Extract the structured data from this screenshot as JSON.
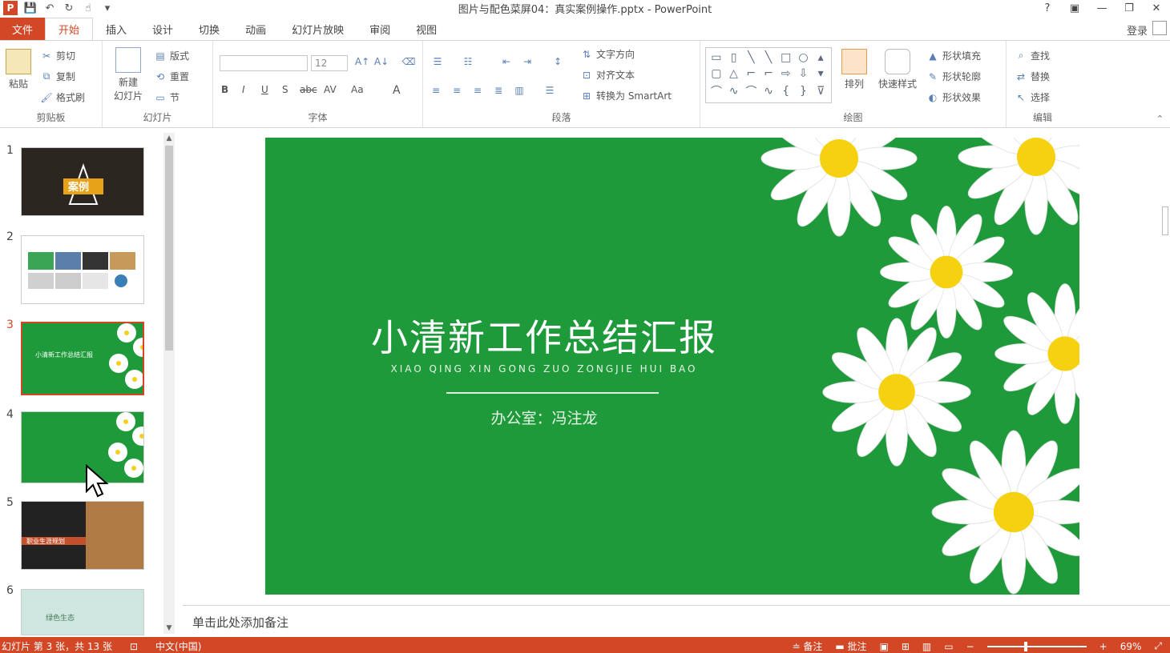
{
  "titlebar": {
    "title": "图片与配色菜屏04：真实案例操作.pptx - PowerPoint",
    "qa_icons": [
      "save-icon",
      "undo-icon",
      "redo-icon",
      "touch-mode-icon",
      "customize-icon"
    ],
    "controls": {
      "help": "?",
      "ribbon_options": "▣",
      "minimize": "—",
      "restore": "❐",
      "close": "✕"
    }
  },
  "tabs": {
    "items": [
      "文件",
      "开始",
      "插入",
      "设计",
      "切换",
      "动画",
      "幻灯片放映",
      "审阅",
      "视图"
    ],
    "active": "开始",
    "login": "登录"
  },
  "ribbon": {
    "clipboard": {
      "paste": "粘贴",
      "cut": "剪切",
      "copy": "复制",
      "format_painter": "格式刷",
      "label": "剪贴板"
    },
    "slides": {
      "new_slide": "新建\n幻灯片",
      "layout": "版式",
      "reset": "重置",
      "section": "节",
      "label": "幻灯片"
    },
    "font": {
      "font_size": "12",
      "bold": "B",
      "italic": "I",
      "underline": "U",
      "shadow": "S",
      "strike": "abc",
      "spacing": "AV",
      "case": "Aa",
      "color": "A",
      "label": "字体"
    },
    "paragraph": {
      "text_direction": "文字方向",
      "align_text": "对齐文本",
      "smartart": "转换为 SmartArt",
      "label": "段落"
    },
    "drawing": {
      "arrange": "排列",
      "quick_styles": "快速样式",
      "shape_fill": "形状填充",
      "shape_outline": "形状轮廓",
      "shape_effects": "形状效果",
      "label": "绘图"
    },
    "editing": {
      "find": "查找",
      "replace": "替换",
      "select": "选择",
      "label": "编辑"
    }
  },
  "thumbnails": [
    {
      "num": "1",
      "inner": "案例"
    },
    {
      "num": "2",
      "inner": ""
    },
    {
      "num": "3",
      "inner": "小清新工作总结汇报"
    },
    {
      "num": "4",
      "inner": ""
    },
    {
      "num": "5",
      "inner": "职业生涯规划"
    },
    {
      "num": "6",
      "inner": "绿色生态"
    }
  ],
  "slide": {
    "title": "小清新工作总结汇报",
    "pinyin": "XIAO QING XIN GONG ZUO ZONGJIE HUI BAO",
    "author": "办公室：冯注龙"
  },
  "notes": {
    "placeholder": "单击此处添加备注"
  },
  "status": {
    "slide_info": "幻灯片 第 3 张，共 13 张",
    "language": "中文(中国)",
    "notes_btn": "备注",
    "comments_btn": "批注",
    "zoom": "69%"
  },
  "colors": {
    "accent": "#d24726",
    "slide_bg": "#1e9a3a"
  }
}
